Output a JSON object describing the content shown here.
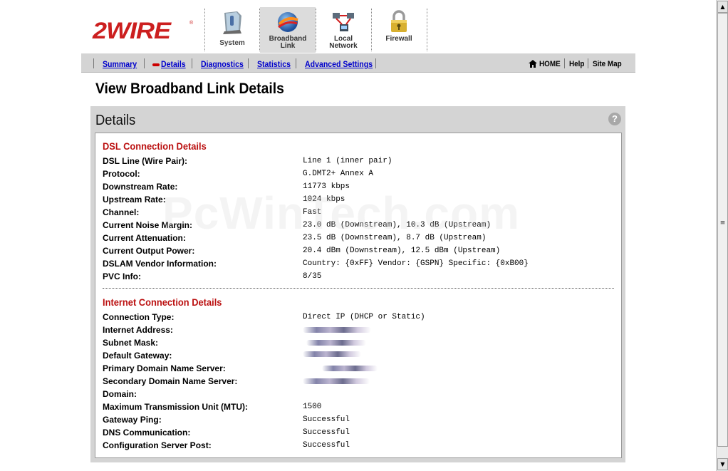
{
  "logo": {
    "text": "2WIRE",
    "registered": "®"
  },
  "top_nav": [
    {
      "label": "System",
      "icon": "system-icon"
    },
    {
      "label": "Broadband\nLink",
      "icon": "broadband-globe-icon",
      "active": true
    },
    {
      "label": "Local\nNetwork",
      "icon": "local-network-icon"
    },
    {
      "label": "Firewall",
      "icon": "firewall-lock-icon"
    }
  ],
  "sub_nav": {
    "links": [
      "Summary",
      "Details",
      "Diagnostics",
      "Statistics",
      "Advanced Settings"
    ],
    "active": "Details",
    "right_links": [
      "HOME",
      "Help",
      "Site Map"
    ],
    "home_icon": "house-icon"
  },
  "page_title": "View Broadband Link Details",
  "panel": {
    "title": "Details",
    "help_icon": "?",
    "dsl": {
      "title": "DSL Connection Details",
      "rows": [
        {
          "label": "DSL Line (Wire Pair):",
          "value": "Line 1 (inner pair)"
        },
        {
          "label": "Protocol:",
          "value": "G.DMT2+ Annex A"
        },
        {
          "label": "Downstream Rate:",
          "value": "11773 kbps"
        },
        {
          "label": "Upstream Rate:",
          "value": "1024 kbps"
        },
        {
          "label": "Channel:",
          "value": "Fast"
        },
        {
          "label": "Current Noise Margin:",
          "value": "23.0 dB (Downstream), 10.3 dB (Upstream)"
        },
        {
          "label": "Current Attenuation:",
          "value": "23.5 dB (Downstream), 8.7 dB (Upstream)"
        },
        {
          "label": "Current Output Power:",
          "value": "20.4 dBm (Downstream), 12.5 dBm (Upstream)"
        },
        {
          "label": "DSLAM Vendor Information:",
          "value": "Country: {0xFF} Vendor: {GSPN} Specific: {0xB00}"
        },
        {
          "label": "PVC Info:",
          "value": "8/35"
        }
      ]
    },
    "internet": {
      "title": "Internet Connection Details",
      "rows": [
        {
          "label": "Connection Type:",
          "value": "Direct IP (DHCP or Static)"
        },
        {
          "label": "Internet Address:",
          "value": ""
        },
        {
          "label": "Subnet Mask:",
          "value": ""
        },
        {
          "label": "Default Gateway:",
          "value": ""
        },
        {
          "label": "Primary Domain Name Server:",
          "value": ""
        },
        {
          "label": "Secondary Domain Name Server:",
          "value": ""
        },
        {
          "label": "Domain:",
          "value": ""
        },
        {
          "label": "Maximum Transmission Unit (MTU):",
          "value": "1500"
        },
        {
          "label": "Gateway Ping:",
          "value": "Successful"
        },
        {
          "label": "DNS Communication:",
          "value": "Successful"
        },
        {
          "label": "Configuration Server Post:",
          "value": "Successful"
        }
      ]
    }
  },
  "watermark": "PcWinTech.com",
  "colors": {
    "brand_red": "#cc1f1f",
    "section_red": "#bb1111",
    "link_blue": "#0000cc",
    "nav_gray": "#d4d4d4"
  },
  "scrollbar": {
    "up_icon": "▲",
    "down_icon": "▼",
    "grip_icon": "≡"
  }
}
